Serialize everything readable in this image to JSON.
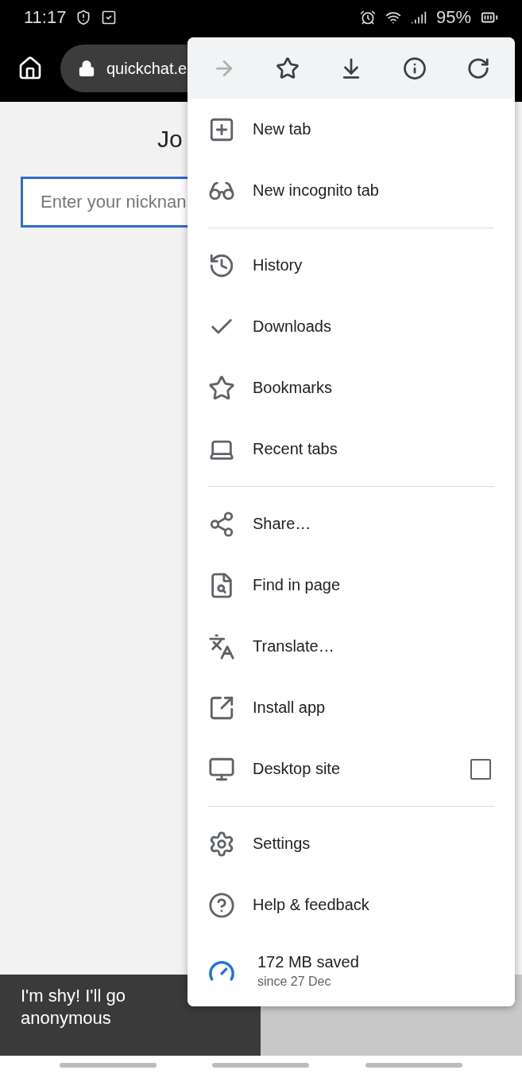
{
  "status_bar": {
    "time": "11:17",
    "battery": "95%"
  },
  "toolbar": {
    "url": "quickchat.e"
  },
  "page": {
    "title": "Jo",
    "nickname_placeholder": "Enter your nicknan",
    "anonymous_button": "I'm shy! I'll go\nanonymous"
  },
  "menu": {
    "actions": [
      {
        "disabled": true
      },
      {
        "disabled": false
      },
      {
        "disabled": false
      },
      {
        "disabled": false
      },
      {
        "disabled": false
      }
    ],
    "sections": [
      [
        {
          "kind": "item",
          "label": "New tab"
        },
        {
          "kind": "item",
          "label": "New incognito tab"
        }
      ],
      [
        {
          "kind": "item",
          "label": "History"
        },
        {
          "kind": "item",
          "label": "Downloads"
        },
        {
          "kind": "item",
          "label": "Bookmarks"
        },
        {
          "kind": "item",
          "label": "Recent tabs"
        }
      ],
      [
        {
          "kind": "item",
          "label": "Share…"
        },
        {
          "kind": "item",
          "label": "Find in page"
        },
        {
          "kind": "item",
          "label": "Translate…"
        },
        {
          "kind": "item",
          "label": "Install app"
        },
        {
          "kind": "checkbox",
          "label": "Desktop site",
          "checked": false
        }
      ],
      [
        {
          "kind": "item",
          "label": "Settings"
        },
        {
          "kind": "item",
          "label": "Help & feedback"
        },
        {
          "kind": "saved",
          "label": "172 MB saved",
          "subtitle": "since 27 Dec"
        }
      ]
    ]
  }
}
